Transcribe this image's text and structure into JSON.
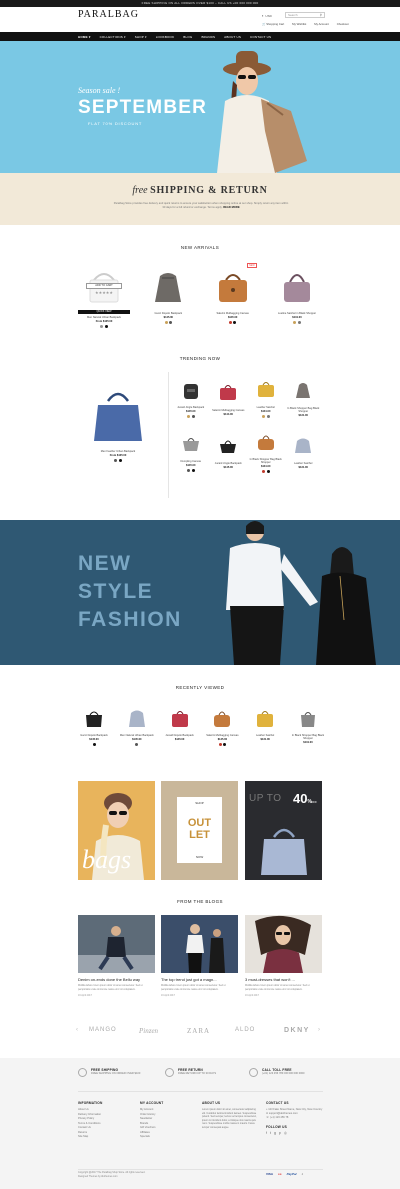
{
  "topbar": {
    "text": "FREE SHIPPING ON ALL ORDERS OVER $100 – CALL US +00 000 000 000"
  },
  "header": {
    "logo": "PARALBAG",
    "currency": "USD",
    "cart": "Shopping Cart",
    "search_placeholder": "Search",
    "links": [
      "My Wishlist",
      "My Account",
      "Checkout"
    ]
  },
  "nav": [
    "HOME",
    "COLLECTIONS",
    "SHOP",
    "LOOKBOOK",
    "BLOG",
    "BRANDS",
    "ABOUT US",
    "CONTACT US"
  ],
  "hero1": {
    "script": "Season sale !",
    "title": "SEPTEMBER",
    "subtitle": "FLAT 70% DISCOUNT"
  },
  "shipping": {
    "free": "free",
    "title": "SHIPPING & RETURN",
    "text": "Paralbag Store provides free delivery and quick returns to ensure your satisfaction when shopping online at our shop. Simply return any item within 30 days for a full refund or exchange. Terms apply.",
    "more": "READ MORE"
  },
  "new_arrivals": {
    "title": "NEW ARRIVALS",
    "add_to_cart": "ADD TO CART",
    "quick_view": "QUICK VIEW",
    "items": [
      {
        "name": "Men Natural Urban Backpack",
        "price": "From $125.00"
      },
      {
        "name": "Gucci Dopolo Backpack",
        "price": "$145.00"
      },
      {
        "name": "Salerini Mulbagging Canvas",
        "price": "$145.00"
      },
      {
        "name": "Lueline Satchel in Black Shopper",
        "price": "$131.00"
      }
    ]
  },
  "trending": {
    "title": "TRENDING NOW",
    "featured": {
      "name": "Men Feather Urban Backpack",
      "price": "From $125.00"
    },
    "items": [
      {
        "name": "Jucaid Jingle Backpack",
        "price": "$145.00"
      },
      {
        "name": "Salerini Mulbagging Canvas",
        "price": "$144.00"
      },
      {
        "name": "Leather Satchel",
        "price": "$131.00"
      },
      {
        "name": "In Black Shopper Bag Black Shopper",
        "price": "$131.00"
      },
      {
        "name": "Dumpling Canvas",
        "price": "$145.00"
      },
      {
        "name": "Jucaid Jingle Backpack",
        "price": "$145.00"
      },
      {
        "name": "In Black Shopper Bag Black Shopper",
        "price": "$131.00"
      },
      {
        "name": "Leather Satchel",
        "price": "$131.00"
      }
    ]
  },
  "hero2": {
    "lines": [
      "NEW",
      "STYLE",
      "FASHION"
    ]
  },
  "recently_viewed": {
    "title": "RECENTLY VIEWED",
    "items": [
      {
        "name": "Gucci Dopolo Backpack",
        "price": "$145.00"
      },
      {
        "name": "Men Natural Urban Backpack",
        "price": "$145.00"
      },
      {
        "name": "Jucaid Dopolo Backpack",
        "price": "$145.00"
      },
      {
        "name": "Salerini Mulbagging Canvas",
        "price": "$145.00"
      },
      {
        "name": "Leather Satchel",
        "price": "$131.00"
      },
      {
        "name": "In Black Shopper Bag Black Shopper",
        "price": "$131.00"
      }
    ]
  },
  "promos": {
    "bags": "bags",
    "outlet_top": "SHOP",
    "outlet_a": "OUT",
    "outlet_b": "LET",
    "outlet_bottom": "NOW",
    "upto": "UP TO",
    "pct": "40",
    "pct_sfx": "%",
    "off": "OFF"
  },
  "blogs": {
    "title": "FROM THE BLOGS",
    "items": [
      {
        "title": "Denim on-ends done the Bellu way",
        "text": "Mollitia labore lorem ipsum dolor sit amet consectetur. Sed ut perspiciatis unde omnis iste natus error sit voluptatem.",
        "date": "16 April 2017"
      },
      {
        "title": "The top trend just got a magn...",
        "text": "Mollitia labore lorem ipsum dolor sit amet consectetur. Sed ut perspiciatis unde omnis iste natus error sit voluptatem.",
        "date": "16 April 2017"
      },
      {
        "title": "3 must-dresses that won't ...",
        "text": "Mollitia labore lorem ipsum dolor sit amet consectetur. Sed ut perspiciatis unde omnis iste natus error sit voluptatem.",
        "date": "16 April 2017"
      }
    ]
  },
  "brands": [
    "MANGO",
    "Pinzen",
    "ZARA",
    "ALDO",
    "DKNY"
  ],
  "footer": {
    "features": [
      {
        "title": "FREE SHIPPING",
        "text": "FREE SHIPPING ON ORDER OVER $100"
      },
      {
        "title": "FREE RETURN",
        "text": "FREE RETURN UP TO 30 DAYS"
      },
      {
        "title": "CALL TOLL FREE",
        "text": "(+01) 123 456 789 OR 000 000 0000"
      }
    ],
    "information": {
      "title": "INFORMATION",
      "items": [
        "About Us",
        "Delivery Information",
        "Privacy Policy",
        "Terms & Conditions",
        "Contact Us",
        "Returns",
        "Site Map"
      ]
    },
    "account": {
      "title": "MY ACCOUNT",
      "items": [
        "My Account",
        "Order History",
        "Newsletter",
        "Brands",
        "Gift Vouchers",
        "Affiliates",
        "Specials"
      ]
    },
    "about": {
      "title": "ABOUT US",
      "text": "Lorem ipsum dolor sit amet, consectetur adipiscing elit. Curabitur lacinia tincidunt laoreet. Suspendisse potenti. Sed semper, lectus vel tempus consectetur, ipsum mi tincidunt dolor, a tristique nisi mauris quis nunc. Suspendisse mollis massa in mauris. Fusce tempor consequat augue."
    },
    "contact": {
      "title": "CONTACT US",
      "items": [
        "123 Fake Street Name, New City, New Country",
        "support@alothemes.com",
        "(+1) 123 456 78"
      ]
    },
    "follow": "FOLLOW US",
    "copyright": "Copyright @2017 The Paralbag Shop Store. All rights reserved.",
    "designed": "Designed Themes by Alothemes.com",
    "payments": [
      "VISA",
      "●●",
      "PayPal",
      "◐"
    ]
  },
  "colors": {
    "accent": "#111111",
    "hero_blue": "#7ac8e4",
    "cream": "#f2e9d8",
    "fashion_bg": "#2f5873"
  }
}
